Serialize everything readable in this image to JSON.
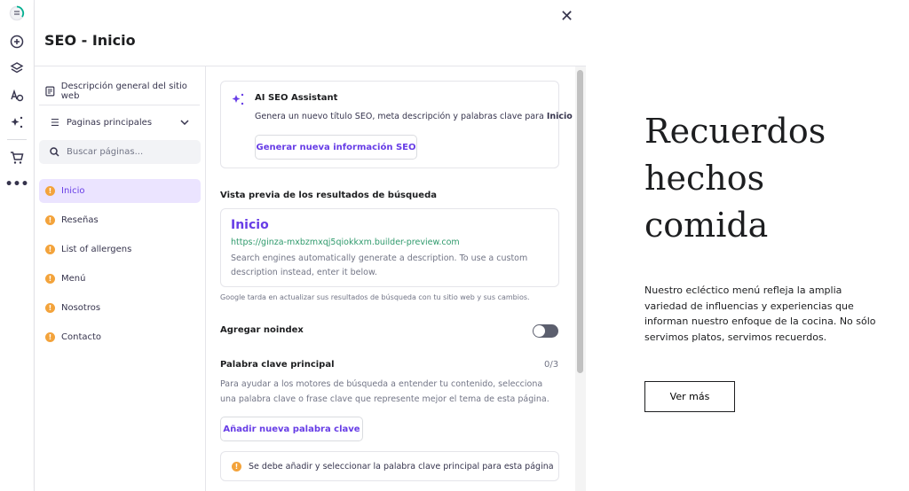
{
  "header": {
    "title": "SEO - Inicio"
  },
  "nav": {
    "overview": "Descripción general del sitio web",
    "pages_dropdown": "Paginas principales",
    "search_placeholder": "Buscar páginas...",
    "items": [
      {
        "label": "Inicio"
      },
      {
        "label": "Reseñas"
      },
      {
        "label": "List of allergens"
      },
      {
        "label": "Menú"
      },
      {
        "label": "Nosotros"
      },
      {
        "label": "Contacto"
      }
    ]
  },
  "ai": {
    "title": "AI SEO Assistant",
    "desc": "Genera un nuevo título SEO, meta descripción y palabras clave para ",
    "desc_bold": "Inicio",
    "button": "Generar nueva información SEO"
  },
  "search_preview": {
    "label": "Vista previa de los resultados de búsqueda",
    "title": "Inicio",
    "url": "https://ginza-mxbzmxqj5qiokkxm.builder-preview.com",
    "desc": "Search engines automatically generate a description. To use a custom description instead, enter it below.",
    "note": "Google tarda en actualizar sus resultados de búsqueda con tu sitio web y sus cambios."
  },
  "noindex": {
    "label": "Agregar noindex",
    "enabled": false
  },
  "keyword": {
    "label": "Palabra clave principal",
    "count": "0/3",
    "desc": "Para ayudar a los motores de búsqueda a entender tu contenido, selecciona una palabra clave o frase clave que represente mejor el tema de esta página.",
    "button": "Añadir nueva palabra clave",
    "warning": "Se debe añadir y seleccionar la palabra clave principal para esta página"
  },
  "site": {
    "heading": "Recuerdos hechos comida",
    "body": "Nuestro ecléctico menú refleja la amplia variedad de influencias y experiencias que informan nuestro enfoque de la cocina. No sólo servimos platos, servimos recuerdos.",
    "button": "Ver más"
  },
  "colors": {
    "accent": "#673de6",
    "url": "#00b090",
    "warning": "#f3a33b"
  }
}
